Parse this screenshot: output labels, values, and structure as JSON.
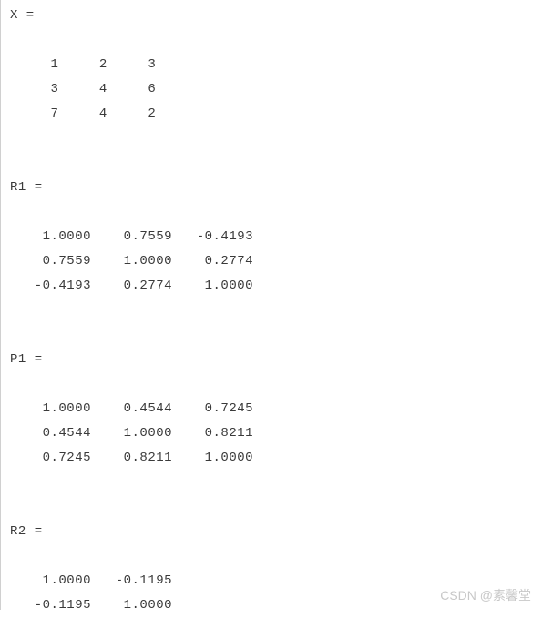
{
  "blocks": [
    {
      "name": "X",
      "rows": [
        "     1     2     3",
        "     3     4     6",
        "     7     4     2"
      ]
    },
    {
      "name": "R1",
      "rows": [
        "    1.0000    0.7559   -0.4193",
        "    0.7559    1.0000    0.2774",
        "   -0.4193    0.2774    1.0000"
      ]
    },
    {
      "name": "P1",
      "rows": [
        "    1.0000    0.4544    0.7245",
        "    0.4544    1.0000    0.8211",
        "    0.7245    0.8211    1.0000"
      ]
    },
    {
      "name": "R2",
      "rows": [
        "    1.0000   -0.1195",
        "   -0.1195    1.0000"
      ]
    }
  ],
  "watermark": "CSDN @素馨堂"
}
